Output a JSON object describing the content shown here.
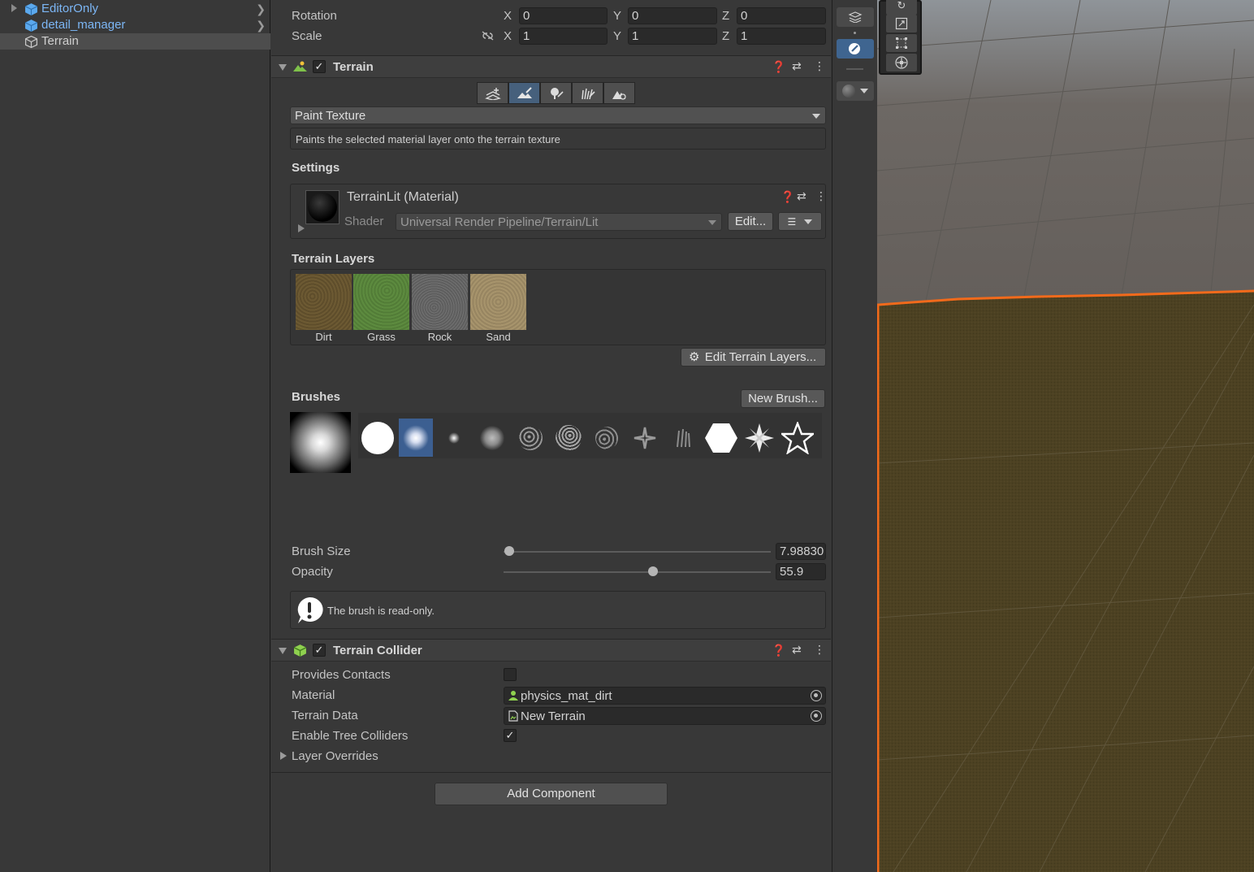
{
  "hierarchy": {
    "items": [
      {
        "label": "EditorOnly",
        "icon": "prefab-cube-icon"
      },
      {
        "label": "detail_manager",
        "icon": "prefab-cube-icon"
      },
      {
        "label": "Terrain",
        "icon": "gameobject-cube-icon"
      }
    ]
  },
  "transform": {
    "rotation_label": "Rotation",
    "scale_label": "Scale",
    "axis_x": "X",
    "axis_y": "Y",
    "axis_z": "Z",
    "rotation": {
      "x": "0",
      "y": "0",
      "z": "0"
    },
    "scale": {
      "x": "1",
      "y": "1",
      "z": "1"
    }
  },
  "terrain": {
    "title": "Terrain",
    "tool_dropdown": "Paint Texture",
    "tool_description": "Paints the selected material layer onto the terrain texture",
    "settings_heading": "Settings",
    "material_name": "TerrainLit (Material)",
    "shader_label": "Shader",
    "shader_value": "Universal Render Pipeline/Terrain/Lit",
    "edit_button": "Edit...",
    "layers_heading": "Terrain Layers",
    "layers": [
      "Dirt",
      "Grass",
      "Rock",
      "Sand"
    ],
    "edit_layers_button": "Edit Terrain Layers...",
    "brushes_heading": "Brushes",
    "new_brush_button": "New Brush...",
    "brush_size_label": "Brush Size",
    "brush_size_value": "7.98830",
    "brush_size_fraction": 0.02,
    "opacity_label": "Opacity",
    "opacity_value": "55.9",
    "opacity_fraction": 0.559,
    "readonly_message": "The brush is read-only."
  },
  "collider": {
    "title": "Terrain Collider",
    "provides_contacts_label": "Provides Contacts",
    "provides_contacts": false,
    "material_label": "Material",
    "material_value": "physics_mat_dirt",
    "terrain_data_label": "Terrain Data",
    "terrain_data_value": "New Terrain",
    "enable_tree_label": "Enable Tree Colliders",
    "enable_tree": true,
    "layer_overrides_label": "Layer Overrides"
  },
  "add_component_button": "Add Component",
  "colors": {
    "accent": "#46607c",
    "selection_outline": "#f26a1b",
    "prefab_text": "#7cb6f5"
  }
}
